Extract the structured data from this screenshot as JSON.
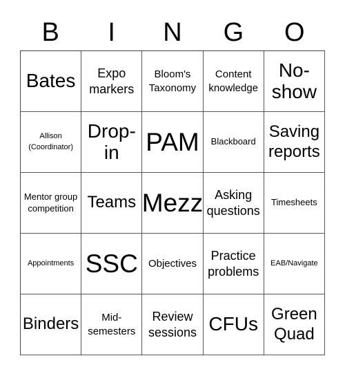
{
  "header": [
    "B",
    "I",
    "N",
    "G",
    "O"
  ],
  "cells": [
    [
      "Bates",
      "Expo markers",
      "Bloom's Taxonomy",
      "Content knowledge",
      "No-show"
    ],
    [
      "Allison (Coordinator)",
      "Drop-in",
      "PAM",
      "Blackboard",
      "Saving reports"
    ],
    [
      "Mentor group competition",
      "Teams",
      "Mezz",
      "Asking questions",
      "Timesheets"
    ],
    [
      "Appointments",
      "SSC",
      "Objectives",
      "Practice problems",
      "EAB/Navigate"
    ],
    [
      "Binders",
      "Mid-semesters",
      "Review sessions",
      "CFUs",
      "Green Quad"
    ]
  ]
}
